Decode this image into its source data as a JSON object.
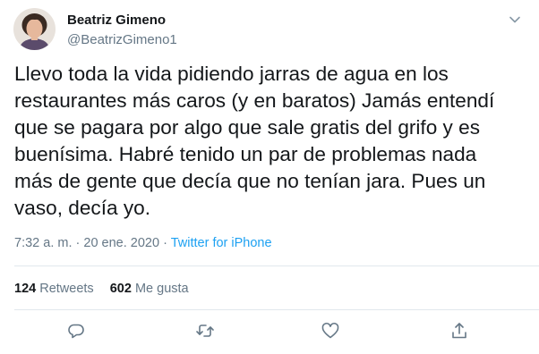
{
  "author": {
    "name": "Beatriz Gimeno",
    "handle": "@BeatrizGimeno1"
  },
  "tweet": {
    "text": "Llevo toda la vida pidiendo jarras de agua en los restaurantes más caros (y en baratos) Jamás entendí que se pagara por algo que sale gratis del grifo y es buenísima. Habré tenido un par de problemas nada más de gente que decía que no tenían jara. Pues un vaso, decía yo.",
    "time": "7:32 a. m.",
    "separator": "·",
    "date": "20 ene. 2020",
    "source": "Twitter for iPhone"
  },
  "stats": {
    "retweets_count": "124",
    "retweets_label": "Retweets",
    "likes_count": "602",
    "likes_label": "Me gusta"
  },
  "icons": {
    "caret": "chevron-down-icon",
    "reply": "reply-icon",
    "retweet": "retweet-icon",
    "like": "heart-icon",
    "share": "share-icon"
  },
  "colors": {
    "text": "#14171a",
    "secondary": "#657786",
    "link": "#1da1f2",
    "divider": "#e1e8ed"
  }
}
